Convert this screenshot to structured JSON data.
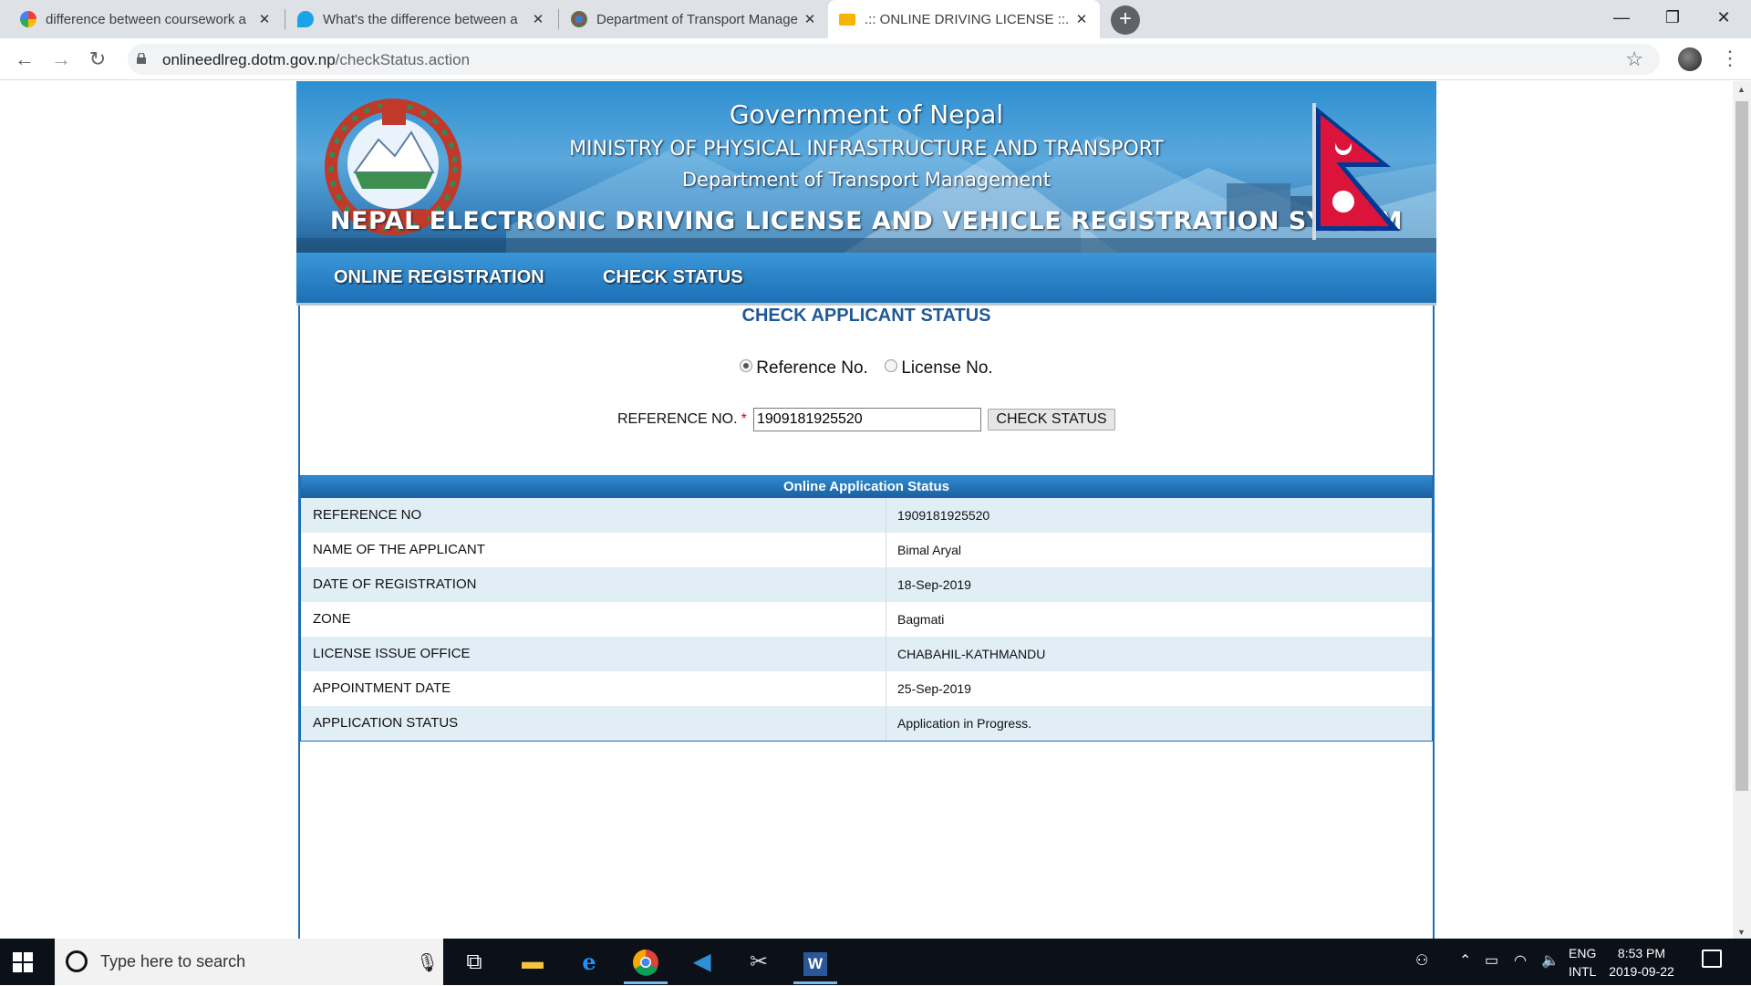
{
  "browser": {
    "tabs": [
      {
        "title": "difference between coursework a",
        "favicon": "google-icon"
      },
      {
        "title": "What's the difference between a",
        "favicon": "quora-icon"
      },
      {
        "title": "Department of Transport Manage",
        "favicon": "emblem-icon"
      },
      {
        "title": ".:: ONLINE DRIVING LICENSE ::.",
        "favicon": "license-card-icon"
      }
    ],
    "active_tab": 3,
    "url_domain": "onlineedlreg.dotm.gov.np",
    "url_path": "/checkStatus.action"
  },
  "banner": {
    "line1": "Government of Nepal",
    "line2": "MINISTRY OF PHYSICAL INFRASTRUCTURE AND TRANSPORT",
    "line3": "Department of Transport Management",
    "line4": "NEPAL ELECTRONIC DRIVING LICENSE AND VEHICLE REGISTRATION SYSTEM"
  },
  "nav": {
    "online_registration": "ONLINE REGISTRATION",
    "check_status": "CHECK STATUS"
  },
  "form": {
    "heading": "CHECK APPLICANT STATUS",
    "radio_reference": "Reference No.",
    "radio_license": "License No.",
    "selected": "reference",
    "ref_label": "REFERENCE NO.",
    "required_mark": "*",
    "ref_value": "1909181925520",
    "button": "CHECK STATUS"
  },
  "status": {
    "title": "Online Application Status",
    "rows": [
      {
        "label": "REFERENCE NO",
        "value": "1909181925520"
      },
      {
        "label": "NAME OF THE APPLICANT",
        "value": "Bimal Aryal"
      },
      {
        "label": "DATE OF REGISTRATION",
        "value": "18-Sep-2019"
      },
      {
        "label": "ZONE",
        "value": "Bagmati"
      },
      {
        "label": "LICENSE ISSUE OFFICE",
        "value": "CHABAHIL-KATHMANDU"
      },
      {
        "label": "APPOINTMENT DATE",
        "value": "25-Sep-2019"
      },
      {
        "label": "APPLICATION STATUS",
        "value": "Application in Progress."
      }
    ]
  },
  "taskbar": {
    "search_placeholder": "Type here to search",
    "lang_top": "ENG",
    "lang_bottom": "INTL",
    "time": "8:53 PM",
    "date": "2019-09-22"
  },
  "colors": {
    "nav_blue": "#1e6fb5",
    "heading_blue": "#1f5a96",
    "row_alt": "#e1eef6"
  }
}
